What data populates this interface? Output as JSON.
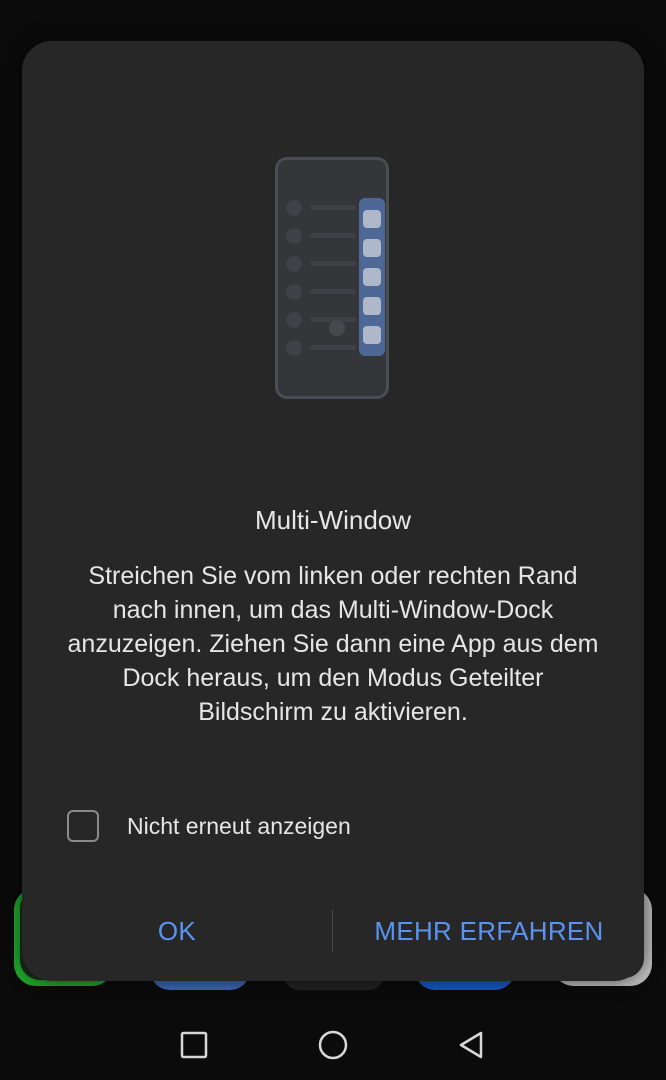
{
  "dialog": {
    "title": "Multi-Window",
    "message": "Streichen Sie vom linken oder rechten Rand nach innen, um das Multi-Window-Dock anzuzeigen. Ziehen Sie dann eine App aus dem Dock heraus, um den Modus Geteilter Bildschirm zu aktivieren.",
    "checkbox_label": "Nicht erneut anzeigen",
    "checkbox_checked": false,
    "ok_label": "OK",
    "learn_more_label": "MEHR ERFAHREN",
    "accent_color": "#5b93f0",
    "illustration_icon": "multi-window-dock-illustration"
  },
  "navbar": {
    "recent_icon": "recent-apps-icon",
    "home_icon": "home-icon",
    "back_icon": "back-icon"
  }
}
